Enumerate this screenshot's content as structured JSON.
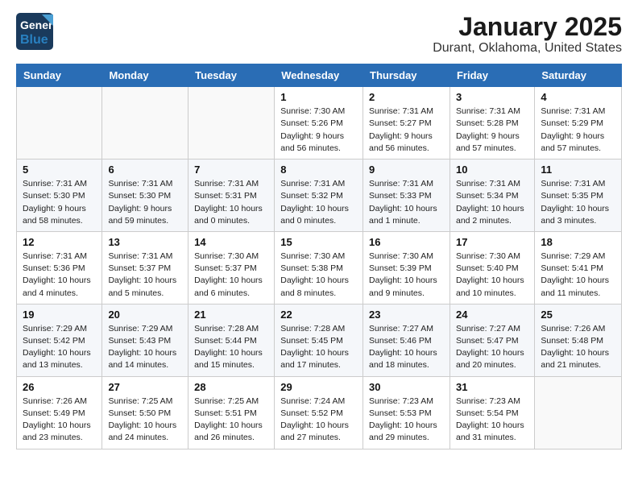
{
  "header": {
    "logo_general": "General",
    "logo_blue": "Blue",
    "title": "January 2025",
    "subtitle": "Durant, Oklahoma, United States"
  },
  "weekdays": [
    "Sunday",
    "Monday",
    "Tuesday",
    "Wednesday",
    "Thursday",
    "Friday",
    "Saturday"
  ],
  "weeks": [
    [
      {
        "num": "",
        "info": ""
      },
      {
        "num": "",
        "info": ""
      },
      {
        "num": "",
        "info": ""
      },
      {
        "num": "1",
        "info": "Sunrise: 7:30 AM\nSunset: 5:26 PM\nDaylight: 9 hours\nand 56 minutes."
      },
      {
        "num": "2",
        "info": "Sunrise: 7:31 AM\nSunset: 5:27 PM\nDaylight: 9 hours\nand 56 minutes."
      },
      {
        "num": "3",
        "info": "Sunrise: 7:31 AM\nSunset: 5:28 PM\nDaylight: 9 hours\nand 57 minutes."
      },
      {
        "num": "4",
        "info": "Sunrise: 7:31 AM\nSunset: 5:29 PM\nDaylight: 9 hours\nand 57 minutes."
      }
    ],
    [
      {
        "num": "5",
        "info": "Sunrise: 7:31 AM\nSunset: 5:30 PM\nDaylight: 9 hours\nand 58 minutes."
      },
      {
        "num": "6",
        "info": "Sunrise: 7:31 AM\nSunset: 5:30 PM\nDaylight: 9 hours\nand 59 minutes."
      },
      {
        "num": "7",
        "info": "Sunrise: 7:31 AM\nSunset: 5:31 PM\nDaylight: 10 hours\nand 0 minutes."
      },
      {
        "num": "8",
        "info": "Sunrise: 7:31 AM\nSunset: 5:32 PM\nDaylight: 10 hours\nand 0 minutes."
      },
      {
        "num": "9",
        "info": "Sunrise: 7:31 AM\nSunset: 5:33 PM\nDaylight: 10 hours\nand 1 minute."
      },
      {
        "num": "10",
        "info": "Sunrise: 7:31 AM\nSunset: 5:34 PM\nDaylight: 10 hours\nand 2 minutes."
      },
      {
        "num": "11",
        "info": "Sunrise: 7:31 AM\nSunset: 5:35 PM\nDaylight: 10 hours\nand 3 minutes."
      }
    ],
    [
      {
        "num": "12",
        "info": "Sunrise: 7:31 AM\nSunset: 5:36 PM\nDaylight: 10 hours\nand 4 minutes."
      },
      {
        "num": "13",
        "info": "Sunrise: 7:31 AM\nSunset: 5:37 PM\nDaylight: 10 hours\nand 5 minutes."
      },
      {
        "num": "14",
        "info": "Sunrise: 7:30 AM\nSunset: 5:37 PM\nDaylight: 10 hours\nand 6 minutes."
      },
      {
        "num": "15",
        "info": "Sunrise: 7:30 AM\nSunset: 5:38 PM\nDaylight: 10 hours\nand 8 minutes."
      },
      {
        "num": "16",
        "info": "Sunrise: 7:30 AM\nSunset: 5:39 PM\nDaylight: 10 hours\nand 9 minutes."
      },
      {
        "num": "17",
        "info": "Sunrise: 7:30 AM\nSunset: 5:40 PM\nDaylight: 10 hours\nand 10 minutes."
      },
      {
        "num": "18",
        "info": "Sunrise: 7:29 AM\nSunset: 5:41 PM\nDaylight: 10 hours\nand 11 minutes."
      }
    ],
    [
      {
        "num": "19",
        "info": "Sunrise: 7:29 AM\nSunset: 5:42 PM\nDaylight: 10 hours\nand 13 minutes."
      },
      {
        "num": "20",
        "info": "Sunrise: 7:29 AM\nSunset: 5:43 PM\nDaylight: 10 hours\nand 14 minutes."
      },
      {
        "num": "21",
        "info": "Sunrise: 7:28 AM\nSunset: 5:44 PM\nDaylight: 10 hours\nand 15 minutes."
      },
      {
        "num": "22",
        "info": "Sunrise: 7:28 AM\nSunset: 5:45 PM\nDaylight: 10 hours\nand 17 minutes."
      },
      {
        "num": "23",
        "info": "Sunrise: 7:27 AM\nSunset: 5:46 PM\nDaylight: 10 hours\nand 18 minutes."
      },
      {
        "num": "24",
        "info": "Sunrise: 7:27 AM\nSunset: 5:47 PM\nDaylight: 10 hours\nand 20 minutes."
      },
      {
        "num": "25",
        "info": "Sunrise: 7:26 AM\nSunset: 5:48 PM\nDaylight: 10 hours\nand 21 minutes."
      }
    ],
    [
      {
        "num": "26",
        "info": "Sunrise: 7:26 AM\nSunset: 5:49 PM\nDaylight: 10 hours\nand 23 minutes."
      },
      {
        "num": "27",
        "info": "Sunrise: 7:25 AM\nSunset: 5:50 PM\nDaylight: 10 hours\nand 24 minutes."
      },
      {
        "num": "28",
        "info": "Sunrise: 7:25 AM\nSunset: 5:51 PM\nDaylight: 10 hours\nand 26 minutes."
      },
      {
        "num": "29",
        "info": "Sunrise: 7:24 AM\nSunset: 5:52 PM\nDaylight: 10 hours\nand 27 minutes."
      },
      {
        "num": "30",
        "info": "Sunrise: 7:23 AM\nSunset: 5:53 PM\nDaylight: 10 hours\nand 29 minutes."
      },
      {
        "num": "31",
        "info": "Sunrise: 7:23 AM\nSunset: 5:54 PM\nDaylight: 10 hours\nand 31 minutes."
      },
      {
        "num": "",
        "info": ""
      }
    ]
  ]
}
